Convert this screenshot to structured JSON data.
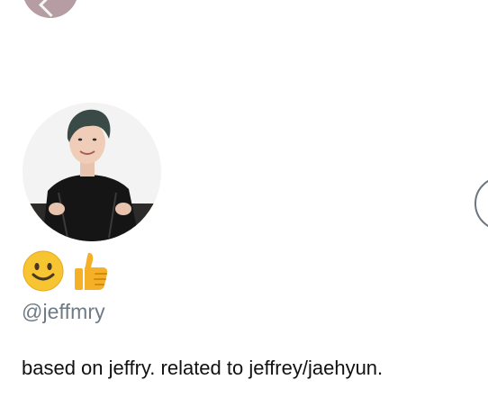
{
  "profile": {
    "emojis": [
      "🙂",
      "👍"
    ],
    "handle": "@jeffmry",
    "bio": "based on jeffry. related to jeffrey/jaehyun."
  },
  "icons": {
    "back": "chevron-left-icon",
    "side": "circle-button-icon"
  },
  "colors": {
    "back_button": "#b69da1",
    "handle_text": "#6e7a86",
    "bio_text": "#111111",
    "side_button_border": "#6b7680"
  }
}
